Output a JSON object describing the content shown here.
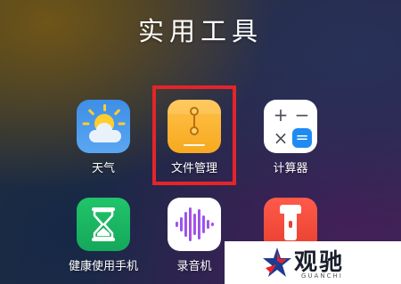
{
  "folder": {
    "title": "实用工具"
  },
  "apps": [
    {
      "label": "天气",
      "icon": "weather-sun-cloud-icon"
    },
    {
      "label": "文件管理",
      "icon": "file-manager-folder-icon"
    },
    {
      "label": "计算器",
      "icon": "calculator-icon"
    },
    {
      "label": "健康使用手机",
      "icon": "hourglass-icon"
    },
    {
      "label": "录音机",
      "icon": "sound-wave-icon"
    },
    {
      "label": "",
      "icon": "flashlight-icon"
    }
  ],
  "highlight": {
    "target": "文件管理",
    "color": "#e5242a"
  },
  "watermark": {
    "brand": "观驰",
    "sub": "GUANCHI"
  }
}
